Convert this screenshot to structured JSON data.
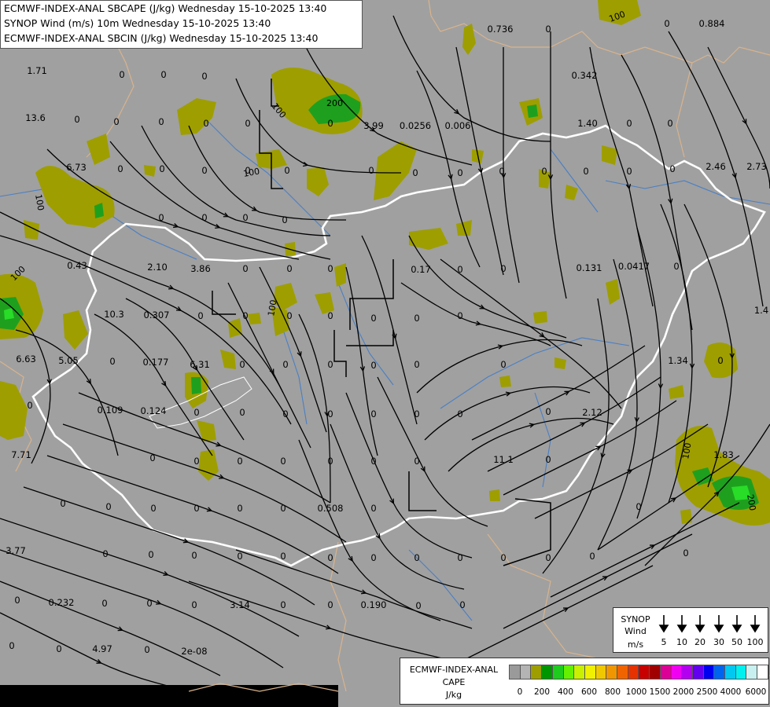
{
  "header": {
    "line1": "ECMWF-INDEX-ANAL SBCAPE (J/kg) Wednesday 15-10-2025 13:40",
    "line2": "SYNOP Wind (m/s) 10m Wednesday 15-10-2025 13:40",
    "line3": "ECMWF-INDEX-ANAL SBCIN (J/kg) Wednesday 15-10-2025 13:40"
  },
  "colors": {
    "background": "#a0a0a0",
    "cape_olive": "#9e9e00",
    "cape_green": "#1ea01e",
    "cape_bright": "#28dc28",
    "border_white": "#ffffff",
    "streamline": "#000000",
    "river": "#4a7fc4",
    "land_border": "#d9b38c"
  },
  "station_values": [
    "1.71",
    "0",
    "0",
    "0",
    "13.6",
    "0",
    "0",
    "0",
    "0",
    "0",
    "0.736",
    "0",
    "0",
    "0.884",
    "6.73",
    "0",
    "0",
    "0",
    "0",
    "0",
    "0",
    "3.99",
    "0.0256",
    "0.006",
    "1.40",
    "0.342",
    "0",
    "0",
    "2.46",
    "2.73",
    "0",
    "0",
    "0",
    "0",
    "0",
    "0",
    "0",
    "0",
    "0",
    "0",
    "0",
    "0",
    "0.43",
    "2.10",
    "3.86",
    "0",
    "0",
    "0",
    "0.17",
    "0",
    "0",
    "0.131",
    "0.0417",
    "0",
    "10.3",
    "0.307",
    "0",
    "0",
    "0",
    "0",
    "0",
    "0",
    "0",
    "1.4",
    "6.63",
    "5.05",
    "0",
    "0.177",
    "6.31",
    "0",
    "0",
    "0",
    "0",
    "0",
    "0",
    "1.34",
    "0",
    "0",
    "0.109",
    "0.124",
    "0",
    "0",
    "0",
    "0",
    "0",
    "0",
    "0",
    "0",
    "2.12",
    "7.71",
    "0",
    "0",
    "0",
    "0",
    "0",
    "0",
    "0",
    "11.1",
    "0",
    "0",
    "0",
    "0",
    "0",
    "0",
    "0",
    "0.508",
    "0",
    "0",
    "1.83",
    "3.77",
    "0",
    "0",
    "0",
    "0",
    "0",
    "0",
    "0",
    "0",
    "0",
    "0",
    "0",
    "0",
    "0",
    "0",
    "0.232",
    "0",
    "0",
    "0",
    "3.14",
    "0",
    "0",
    "0.190",
    "0",
    "0",
    "0",
    "0",
    "4.97",
    "0",
    "2e-08"
  ],
  "contour_labels": [
    "100",
    "100",
    "200",
    "100",
    "100",
    "100",
    "100",
    "100",
    "200"
  ],
  "synop_legend": {
    "title1": "SYNOP",
    "title2": "Wind",
    "title3": "m/s",
    "speeds": [
      "5",
      "10",
      "20",
      "30",
      "50",
      "100"
    ]
  },
  "cape_legend": {
    "title1": "ECMWF-INDEX-ANAL",
    "title2": "CAPE",
    "title3": "J/kg",
    "swatches": [
      "#9a9a9a",
      "#b4b4b4",
      "#9e9e00",
      "#009600",
      "#1ecc1e",
      "#64f000",
      "#c8f000",
      "#f0f000",
      "#f0c800",
      "#f09600",
      "#f06400",
      "#e63200",
      "#c80000",
      "#a00000",
      "#dc0096",
      "#f000f0",
      "#b400f0",
      "#6400f0",
      "#0000f0",
      "#0064f0",
      "#00c8f0",
      "#00f0f0",
      "#c8f0f0",
      "#ffffff"
    ],
    "ticks": [
      "0",
      "200",
      "400",
      "600",
      "800",
      "1000",
      "1500",
      "2000",
      "2500",
      "4000",
      "6000"
    ]
  }
}
